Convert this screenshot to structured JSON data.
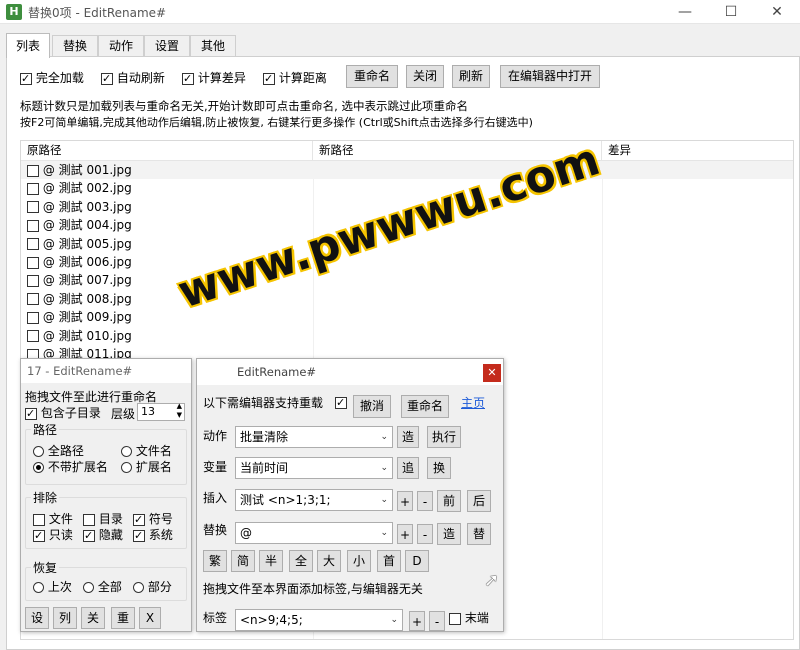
{
  "window": {
    "icon": "H",
    "title": "替换0项 - EditRename#"
  },
  "tabs": [
    {
      "label": "列表"
    },
    {
      "label": "替换"
    },
    {
      "label": "动作"
    },
    {
      "label": "设置"
    },
    {
      "label": "其他"
    }
  ],
  "options": [
    {
      "label": "完全加载",
      "checked": true
    },
    {
      "label": "自动刷新",
      "checked": true
    },
    {
      "label": "计算差异",
      "checked": true
    },
    {
      "label": "计算距离",
      "checked": true
    }
  ],
  "toolbar": {
    "rename": "重命名",
    "close": "关闭",
    "refresh": "刷新",
    "open_editor": "在编辑器中打开"
  },
  "hints": [
    "标题计数只是加载列表与重命名无关,开始计数即可点击重命名, 选中表示跳过此项重命名",
    "按F2可简单编辑,完成其他动作后编辑,防止被恢复, 右键某行更多操作 (Ctrl或Shift点击选择多行右键选中)"
  ],
  "columns": [
    "原路径",
    "新路径",
    "差异"
  ],
  "rows": [
    "@ 測試 001.jpg",
    "@ 測試 002.jpg",
    "@ 測試 003.jpg",
    "@ 測試 004.jpg",
    "@ 測試 005.jpg",
    "@ 測試 006.jpg",
    "@ 測試 007.jpg",
    "@ 測試 008.jpg",
    "@ 測試 009.jpg",
    "@ 測試 010.jpg",
    "@ 測試 011.jpg"
  ],
  "mini": {
    "title": "17 - EditRename#",
    "drag_hint": "拖拽文件至此进行重命名",
    "include_sub": "包含子目录",
    "level_label": "层级",
    "level_value": "13",
    "path_group": "路径",
    "path_opts": [
      "全路径",
      "文件名",
      "不带扩展名",
      "扩展名"
    ],
    "exclude_group": "排除",
    "exclude_opts": [
      {
        "label": "文件",
        "checked": false
      },
      {
        "label": "目录",
        "checked": false
      },
      {
        "label": "符号",
        "checked": true
      },
      {
        "label": "只读",
        "checked": true
      },
      {
        "label": "隐藏",
        "checked": true
      },
      {
        "label": "系统",
        "checked": true
      }
    ],
    "restore_group": "恢复",
    "restore_opts": [
      "上次",
      "全部",
      "部分"
    ],
    "bottom_buttons": [
      "设",
      "列",
      "关",
      "重",
      "X"
    ]
  },
  "editor": {
    "title": "EditRename#",
    "support_label": "以下需编辑器支持重载",
    "undo": "撤消",
    "rename": "重命名",
    "home_link": "主页",
    "action_label": "动作",
    "action_value": "批量清除",
    "action_btns": [
      "造",
      "执行"
    ],
    "var_label": "变量",
    "var_value": "当前时间",
    "var_btns": [
      "追",
      "换"
    ],
    "insert_label": "插入",
    "insert_value": "测试 <n>1;3;1;",
    "insert_btns": [
      "+",
      "-",
      "前",
      "后"
    ],
    "replace_label": "替换",
    "replace_value": "@",
    "replace_btns": [
      "+",
      "-",
      "造",
      "替"
    ],
    "char_btns": [
      "繁",
      "简",
      "半",
      "全",
      "大",
      "小",
      "首",
      "D"
    ],
    "drop_hint": "拖拽文件至本界面添加标签,与编辑器无关",
    "tag_label": "标签",
    "tag_value": "<n>9;4;5;",
    "tag_btns": [
      "+",
      "-"
    ],
    "tail_label": "末端"
  },
  "watermark": "www.pwwwu.com"
}
